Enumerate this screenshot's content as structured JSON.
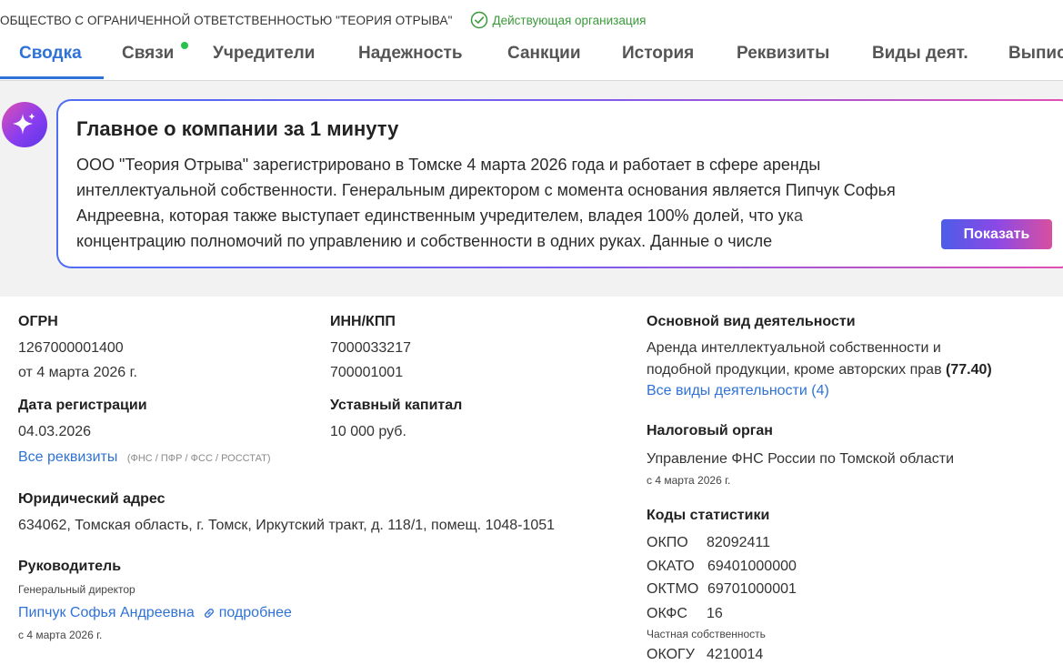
{
  "header": {
    "org_name": "ОБЩЕСТВО С ОГРАНИЧЕННОЙ ОТВЕТСТВЕННОСТЬЮ \"ТЕОРИЯ ОТРЫВА\"",
    "status": "Действующая организация"
  },
  "tabs": [
    {
      "label": "Сводка",
      "active": true
    },
    {
      "label": "Связи",
      "has_dot": true
    },
    {
      "label": "Учредители"
    },
    {
      "label": "Надежность"
    },
    {
      "label": "Санкции"
    },
    {
      "label": "История"
    },
    {
      "label": "Реквизиты"
    },
    {
      "label": "Виды деят."
    },
    {
      "label": "Выпис"
    }
  ],
  "summary": {
    "title": "Главное о компании за 1 минуту",
    "lines": [
      "ООО \"Теория Отрыва\" зарегистрировано в Томске 4 марта 2026 года и работает в сфере аренды",
      "интеллектуальной собственности. Генеральным директором с момента основания является Пипчук Софья",
      "Андреевна, которая также выступает единственным учредителем, владея 100% долей, что ука",
      "концентрацию полномочий по управлению и собственности в одних руках. Данные о числе"
    ],
    "show_button": "Показать"
  },
  "details": {
    "ogrn": {
      "label": "ОГРН",
      "value": "1267000001400",
      "date": "от 4 марта 2026 г."
    },
    "inn_kpp": {
      "label": "ИНН/КПП",
      "inn": "7000033217",
      "kpp": "700001001"
    },
    "reg_date": {
      "label": "Дата регистрации",
      "value": "04.03.2026"
    },
    "capital": {
      "label": "Уставный капитал",
      "value": "10 000 руб."
    },
    "all_requisites": {
      "link": "Все реквизиты",
      "note": "(ФНС / ПФР / ФСС / РОССТАТ)"
    },
    "address": {
      "label": "Юридический адрес",
      "value": "634062, Томская область, г. Томск, Иркутский тракт, д. 118/1, помещ. 1048-1051"
    },
    "head": {
      "label": "Руководитель",
      "position": "Генеральный директор",
      "name": "Пипчук Софья Андреевна",
      "more": "подробнее",
      "date": "с 4 марта 2026 г."
    },
    "activity": {
      "label": "Основной вид деятельности",
      "line1": "Аренда интеллектуальной собственности и",
      "line2": "подобной продукции, кроме авторских прав",
      "code": "(77.40)",
      "all": "Все виды деятельности (4)"
    },
    "tax": {
      "label": "Налоговый орган",
      "value": "Управление ФНС России по Томской области",
      "date": "с 4 марта 2026 г."
    },
    "stats": {
      "label": "Коды статистики",
      "okpo_label": "ОКПО",
      "okpo": "82092411",
      "okato_label": "ОКАТО",
      "okato": "69401000000",
      "oktmo_label": "ОКТМО",
      "oktmo": "69701000001",
      "okfs_label": "ОКФС",
      "okfs": "16",
      "okfs_note": "Частная собственность",
      "okogu_label": "ОКОГУ",
      "okogu": "4210014"
    }
  },
  "colors": {
    "accent": "#2f72d6",
    "status_green": "#3a9a3a",
    "dot_green": "#27c24c",
    "band_bg": "#f2f2f3"
  },
  "icons": {
    "status": "check-circle-icon",
    "ai": "sparkle-icon",
    "link": "link-icon"
  }
}
